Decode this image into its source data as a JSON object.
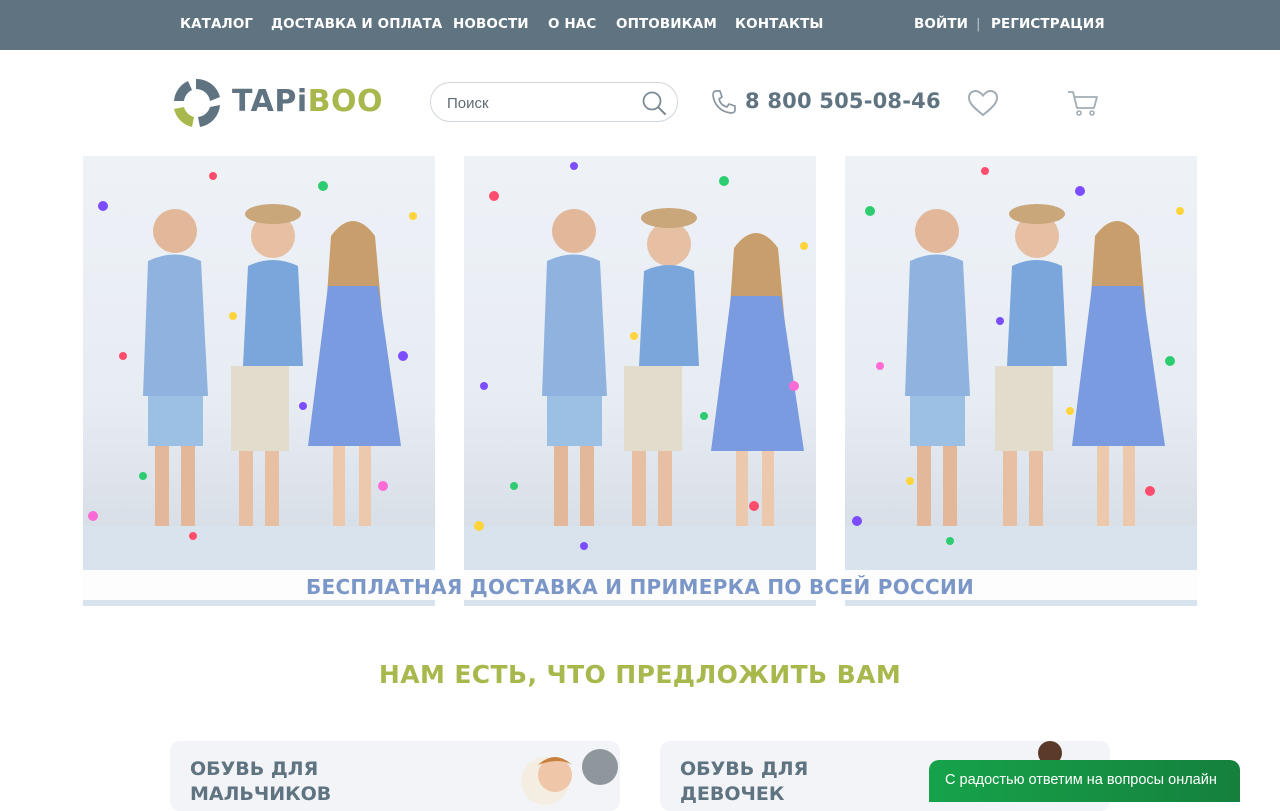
{
  "nav": {
    "items": [
      "КАТАЛОГ",
      "ДОСТАВКА И ОПЛАТА",
      "НОВОСТИ",
      "О НАС",
      "ОПТОВИКАМ",
      "КОНТАКТЫ"
    ]
  },
  "auth": {
    "login": "ВОЙТИ",
    "separator": "|",
    "register": "РЕГИСТРАЦИЯ"
  },
  "logo": {
    "part1": "TAPi",
    "part2": "BOO"
  },
  "search": {
    "placeholder": "Поиск",
    "value": ""
  },
  "phone": "8 800 505-08-46",
  "icons": {
    "search": "search-icon",
    "phone": "phone-icon",
    "favorites": "heart-icon",
    "cart": "cart-icon"
  },
  "banner": {
    "caption": "БЕСПЛАТНАЯ ДОСТАВКА И ПРИМЕРКА ПО ВСЕЙ РОССИИ"
  },
  "section": {
    "title": "НАМ ЕСТЬ, ЧТО ПРЕДЛОЖИТЬ ВАМ"
  },
  "categories": [
    {
      "title": "ОБУВЬ ДЛЯ МАЛЬЧИКОВ"
    },
    {
      "title": "ОБУВЬ ДЛЯ ДЕВОЧЕК"
    }
  ],
  "chat": {
    "label": "С радостью ответим на вопросы онлайн"
  },
  "colors": {
    "header": "#5f7380",
    "accent": "#a9b84c",
    "banner_text": "#7b97c8",
    "chat": "#16a34a"
  }
}
